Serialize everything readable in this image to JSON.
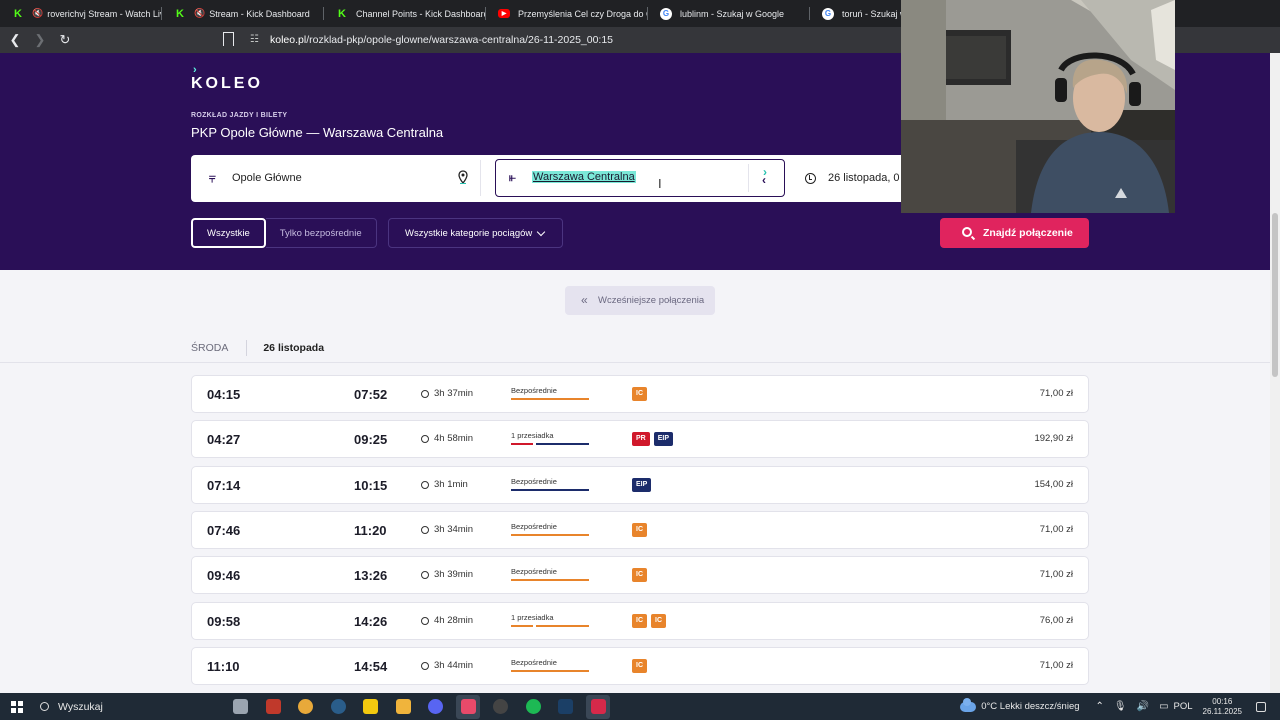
{
  "browser": {
    "tabs": [
      {
        "title": "roverichvj Stream - Watch Live o",
        "icon": "kick-icon",
        "muted": true
      },
      {
        "title": "Stream - Kick Dashboard",
        "icon": "kick-icon",
        "muted": true
      },
      {
        "title": "Channel Points - Kick Dashboard",
        "icon": "kick-icon",
        "muted": false
      },
      {
        "title": "Przemyślenia Cel czy Droga do Celu",
        "icon": "youtube-icon",
        "muted": false
      },
      {
        "title": "lublinm - Szukaj w Google",
        "icon": "google-icon",
        "muted": false
      },
      {
        "title": "toruń - Szukaj w G",
        "icon": "google-icon",
        "muted": false
      }
    ],
    "url_domain": "koleo.pl",
    "url_path": "/rozklad-pkp/opole-glowne/warszawa-centralna/26-11-2025_00:15"
  },
  "header": {
    "logo": "KOLEO",
    "subheading": "ROZKŁAD JAZDY I BILETY",
    "route_title": "PKP Opole Główne — Warszawa Centralna"
  },
  "search": {
    "from": "Opole Główne",
    "to": "Warszawa Centralna",
    "date": "26 listopada, 0",
    "filter_all": "Wszystkie",
    "filter_direct": "Tylko bezpośrednie",
    "categories": "Wszystkie kategorie pociągów",
    "find_button": "Znajdź połączenie"
  },
  "results": {
    "earlier_button": "Wcześniejsze połączenia",
    "day_name": "ŚRODA",
    "day_date": "26 listopada",
    "connections": [
      {
        "dep": "04:15",
        "arr": "07:52",
        "duration": "3h 37min",
        "type": "Bezpośrednie",
        "segments": [
          "IC"
        ],
        "price": "71,00 zł"
      },
      {
        "dep": "04:27",
        "arr": "09:25",
        "duration": "4h 58min",
        "type": "1 przesiadka",
        "segments": [
          "PR",
          "EIP"
        ],
        "price": "192,90 zł"
      },
      {
        "dep": "07:14",
        "arr": "10:15",
        "duration": "3h 1min",
        "type": "Bezpośrednie",
        "segments": [
          "EIP"
        ],
        "price": "154,00 zł"
      },
      {
        "dep": "07:46",
        "arr": "11:20",
        "duration": "3h 34min",
        "type": "Bezpośrednie",
        "segments": [
          "IC"
        ],
        "price": "71,00 zł"
      },
      {
        "dep": "09:46",
        "arr": "13:26",
        "duration": "3h 39min",
        "type": "Bezpośrednie",
        "segments": [
          "IC"
        ],
        "price": "71,00 zł"
      },
      {
        "dep": "09:58",
        "arr": "14:26",
        "duration": "4h 28min",
        "type": "1 przesiadka",
        "segments": [
          "IC",
          "IC"
        ],
        "price": "76,00 zł"
      },
      {
        "dep": "11:10",
        "arr": "14:54",
        "duration": "3h 44min",
        "type": "Bezpośrednie",
        "segments": [
          "IC"
        ],
        "price": "71,00 zł"
      }
    ]
  },
  "colors": {
    "IC": "#e8842b",
    "PR": "#d0182b",
    "EIP": "#1c2c6b",
    "brand": "#2a0f57",
    "accent": "#e0245e"
  },
  "taskbar": {
    "search_placeholder": "Wyszukaj",
    "weather": "0°C  Lekki deszcz/śnieg",
    "language": "POL",
    "time": "00:16",
    "date": "26.11.2025"
  }
}
